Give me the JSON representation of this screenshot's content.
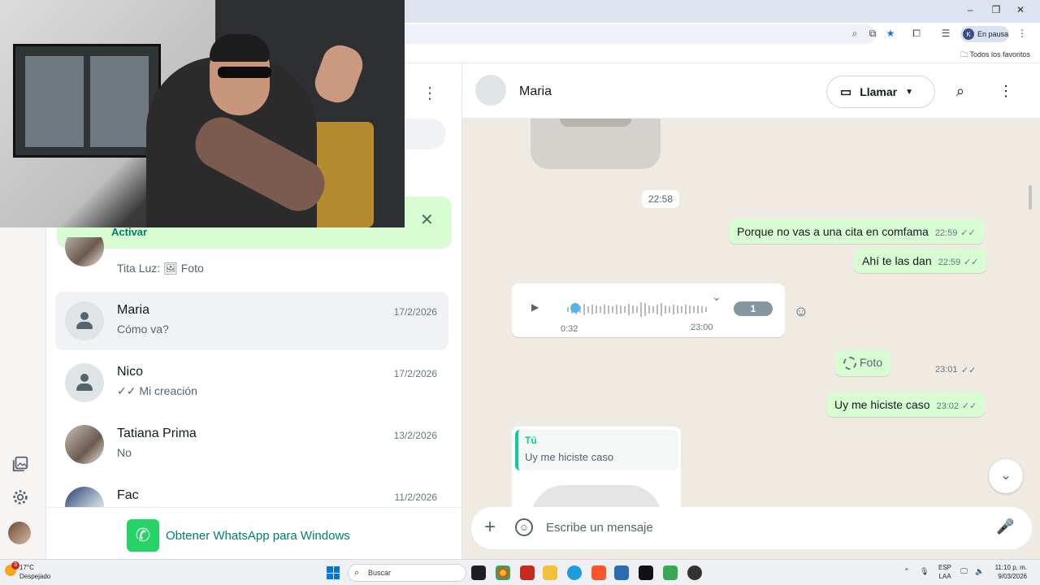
{
  "browser": {
    "minimize": "–",
    "restore": "❐",
    "close": "✕",
    "profile_initial": "K",
    "profile_status": "En pausa",
    "bookmarks_label": "Todos los favoritos"
  },
  "sidebar": {
    "notice_action": "Activar",
    "chats": [
      {
        "name": "",
        "date": "",
        "preview_sender": "Tita Luz:",
        "preview": "Foto"
      },
      {
        "name": "Maria",
        "date": "17/2/2026",
        "preview": "Cómo va?"
      },
      {
        "name": "Nico",
        "date": "17/2/2026",
        "preview": "Mi creación"
      },
      {
        "name": "Tatiana Prima",
        "date": "13/2/2026",
        "preview": "No"
      },
      {
        "name": "Fac",
        "date": "11/2/2026",
        "preview": ""
      }
    ],
    "get_app": "Obtener WhatsApp para Windows"
  },
  "conversation": {
    "contact_name": "Maria",
    "call_label": "Llamar",
    "date_divider": "22:58",
    "messages": [
      {
        "text": "Porque no vas a una cita en comfama",
        "time": "22:59"
      },
      {
        "text": "Ahí te las dan",
        "time": "22:59"
      },
      {
        "text": "Foto",
        "time": "23:01"
      },
      {
        "text": "Uy me hiciste caso",
        "time": "23:02"
      }
    ],
    "voice_note": {
      "duration": "0:32",
      "time": "23:00",
      "speed": "1"
    },
    "reply": {
      "author": "Tú",
      "quoted": "Uy me hiciste caso"
    },
    "composer_placeholder": "Escribe un mensaje"
  },
  "taskbar": {
    "weather_temp": "17°C",
    "weather_desc": "Despejado",
    "weather_badge": "3",
    "search_label": "Buscar",
    "lang_top": "ESP",
    "lang_bottom": "LAA",
    "time": "11:10 p. m.",
    "date": "9/03/2026"
  },
  "colors": {
    "accent": "#008069",
    "outgoing_bubble": "#d9fdd3",
    "chat_background": "#efeae2",
    "voice_progress": "#4fb6ec"
  }
}
